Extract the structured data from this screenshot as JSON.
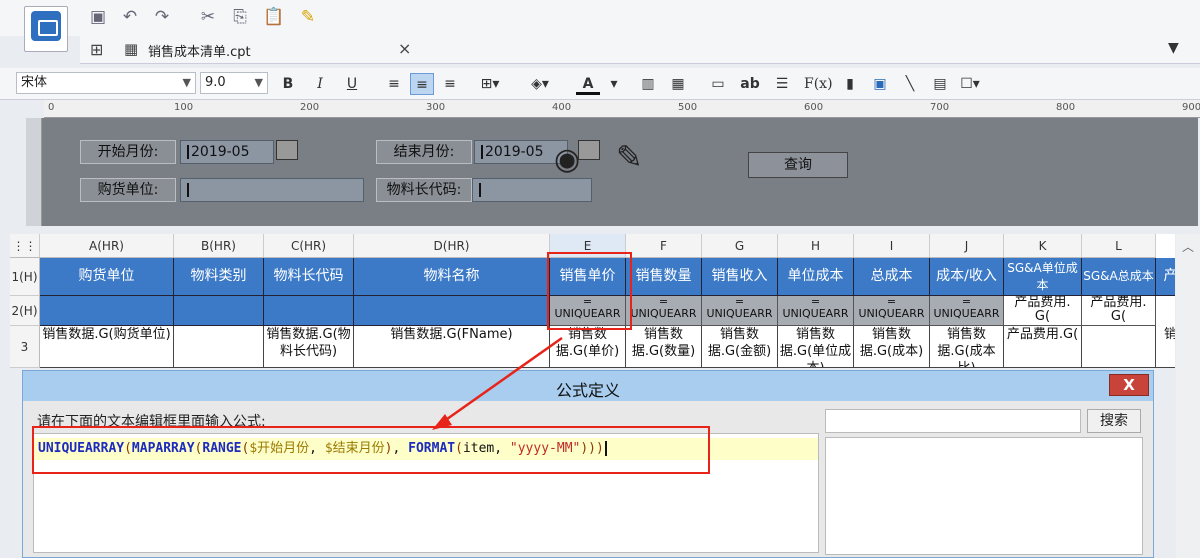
{
  "toolbar": {
    "icons": [
      "save-icon",
      "undo-icon",
      "redo-icon",
      "cut-icon",
      "copy-icon",
      "paste-icon",
      "format-painter-icon"
    ]
  },
  "tab": {
    "title": "销售成本清单.cpt",
    "close": "×"
  },
  "format_toolbar": {
    "font_name": "宋体",
    "font_size": "9.0",
    "bold": "B",
    "italic": "I",
    "underline": "U",
    "font_color_label": "A",
    "text_tool": "ab",
    "formula_tool": "F(x)"
  },
  "ruler": {
    "ticks": [
      "0",
      "100",
      "200",
      "300",
      "400",
      "500",
      "600",
      "700",
      "800",
      "900"
    ]
  },
  "params": {
    "start_month_label": "开始月份:",
    "start_month_value": "2019-05",
    "end_month_label": "结束月份:",
    "end_month_value": "2019-05",
    "supplier_label": "购货单位:",
    "material_code_label": "物料长代码:",
    "query_button": "查询"
  },
  "grid": {
    "columns": [
      "A(HR)",
      "B(HR)",
      "C(HR)",
      "D(HR)",
      "E",
      "F",
      "G",
      "H",
      "I",
      "J",
      "K",
      "L"
    ],
    "rows": [
      "1(H)",
      "2(H)",
      "3"
    ],
    "header_cells": [
      "购货单位",
      "物料类别",
      "物料长代码",
      "物料名称",
      "销售单价",
      "销售数量",
      "销售收入",
      "单位成本",
      "总成本",
      "成本/收入",
      "SG&A单位成本",
      "SG&A总成本",
      "产"
    ],
    "expr_cells": [
      "=\nUNIQUEARR",
      "=\nUNIQUEARR",
      "=\nUNIQUEARR",
      "=\nUNIQUEARR",
      "=\nUNIQUEARR",
      "=\nUNIQUEARR",
      "产品费用.\nG(",
      "产品费用.\nG("
    ],
    "data_cells": [
      "销售数据.G(购货单位)",
      "",
      "销售数据.G(物料长代码)",
      "销售数据.G(FName)",
      "销售数据.G(单价)",
      "销售数据.G(数量)",
      "销售数据.G(金额)",
      "销售数据.G(单位成本)",
      "销售数据.G(成本)",
      "销售数据.G(成本比)",
      "产品费用.G(",
      "",
      "销"
    ]
  },
  "dialog": {
    "title": "公式定义",
    "close": "X",
    "prompt": "请在下面的文本编辑框里面输入公式:",
    "search_button": "搜索",
    "formula_tokens": [
      {
        "t": "UNIQUEARRAY",
        "c": "fn"
      },
      {
        "t": "(",
        "c": "par"
      },
      {
        "t": "MAPARRAY",
        "c": "fn"
      },
      {
        "t": "(",
        "c": "par"
      },
      {
        "t": "RANGE",
        "c": "fn"
      },
      {
        "t": "(",
        "c": "par"
      },
      {
        "t": "$开始月份",
        "c": "var"
      },
      {
        "t": ", ",
        "c": "txt"
      },
      {
        "t": "$结束月份",
        "c": "var"
      },
      {
        "t": ")",
        "c": "par"
      },
      {
        "t": ", ",
        "c": "txt"
      },
      {
        "t": "FORMAT",
        "c": "fn"
      },
      {
        "t": "(",
        "c": "par"
      },
      {
        "t": "item",
        "c": "txt"
      },
      {
        "t": ", ",
        "c": "txt"
      },
      {
        "t": "\"yyyy-MM\"",
        "c": "str"
      },
      {
        "t": ")))",
        "c": "par"
      }
    ]
  },
  "colors": {
    "header_blue": "#3c7ac8",
    "annotation_red": "#e8241a",
    "dialog_title": "#a8cdef"
  }
}
